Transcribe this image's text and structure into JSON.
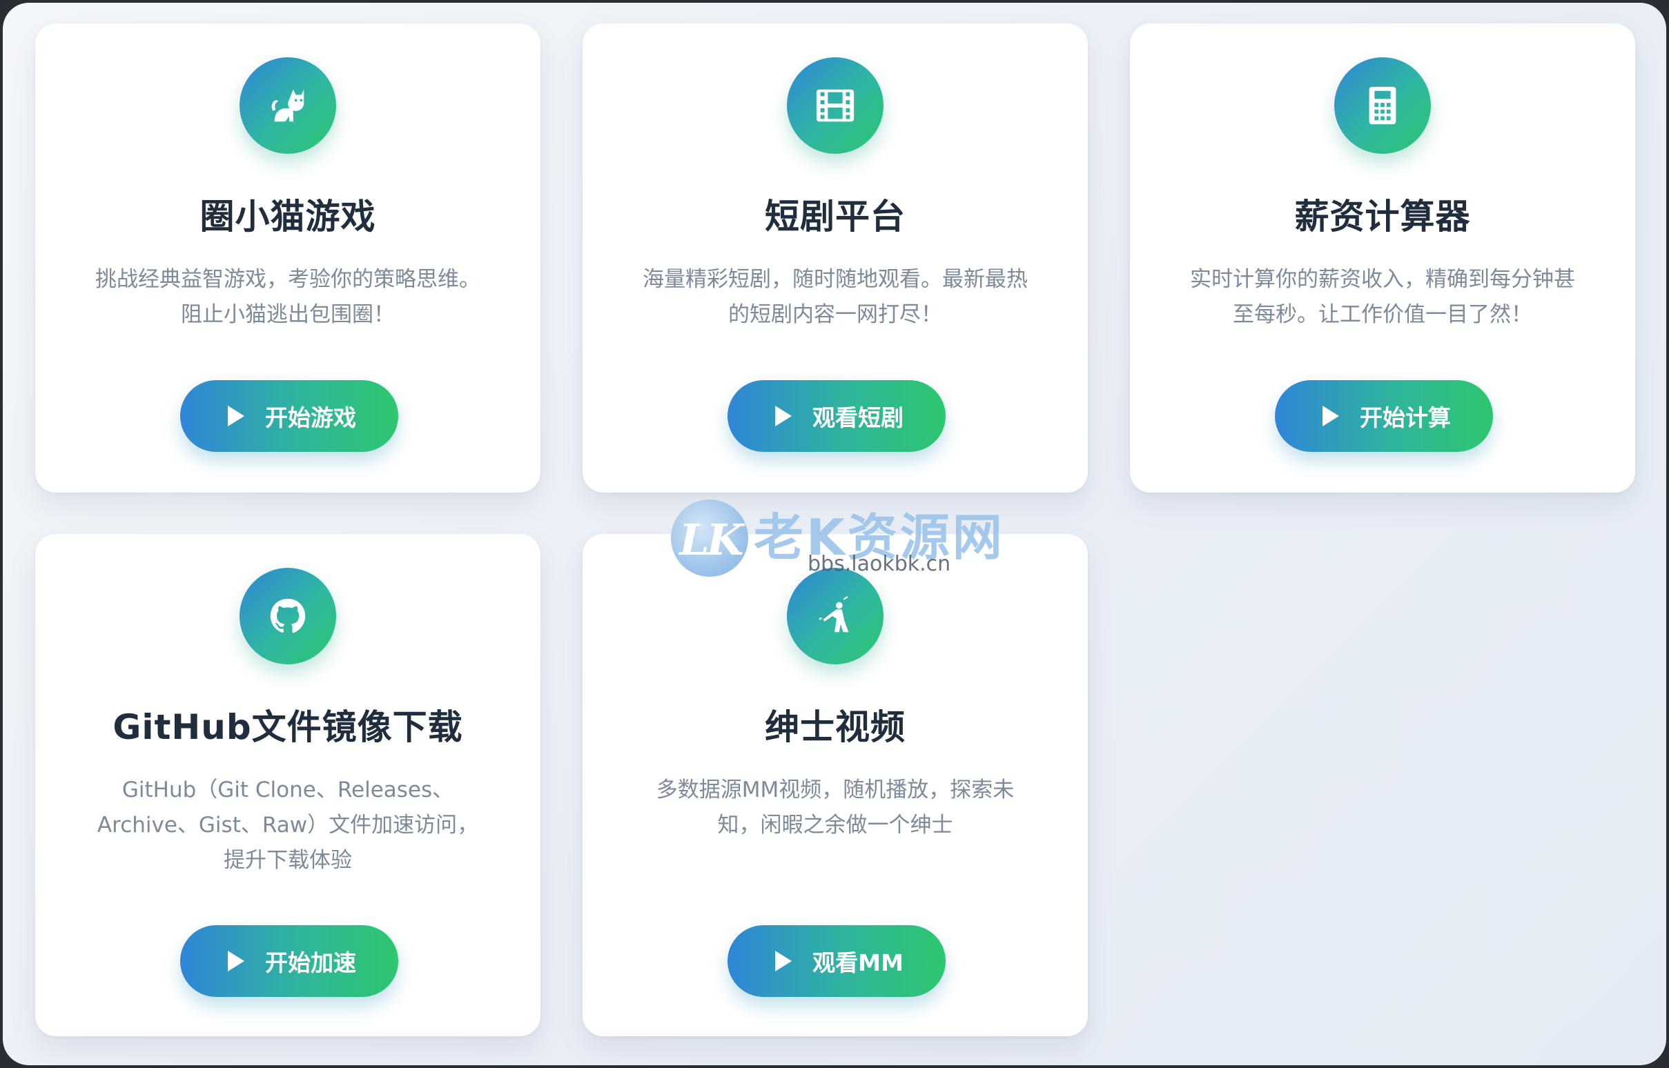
{
  "cards": [
    {
      "title": "圈小猫游戏",
      "description": "挑战经典益智游戏，考验你的策略思维。阻止小猫逃出包围圈！",
      "button": "开始游戏",
      "icon": "cat-icon"
    },
    {
      "title": "短剧平台",
      "description": "海量精彩短剧，随时随地观看。最新最热的短剧内容一网打尽！",
      "button": "观看短剧",
      "icon": "film-icon"
    },
    {
      "title": "薪资计算器",
      "description": "实时计算你的薪资收入，精确到每分钟甚至每秒。让工作价值一目了然！",
      "button": "开始计算",
      "icon": "calculator-icon"
    },
    {
      "title": "GitHub文件镜像下载",
      "description": "GitHub（Git Clone、Releases、Archive、Gist、Raw）文件加速访问，提升下载体验",
      "button": "开始加速",
      "icon": "github-icon"
    },
    {
      "title": "绅士视频",
      "description": "多数据源MM视频，随机播放，探索未知，闲暇之余做一个绅士",
      "button": "观看MM",
      "icon": "person-icon"
    }
  ],
  "watermark": {
    "logo_text": "LK",
    "title": "老K资源网",
    "url": "bbs.laokbk.cn"
  },
  "colors": {
    "gradient_start": "#2f86d8",
    "gradient_end": "#2ec66e",
    "title": "#1f2d3d",
    "description": "#7c8a99"
  }
}
